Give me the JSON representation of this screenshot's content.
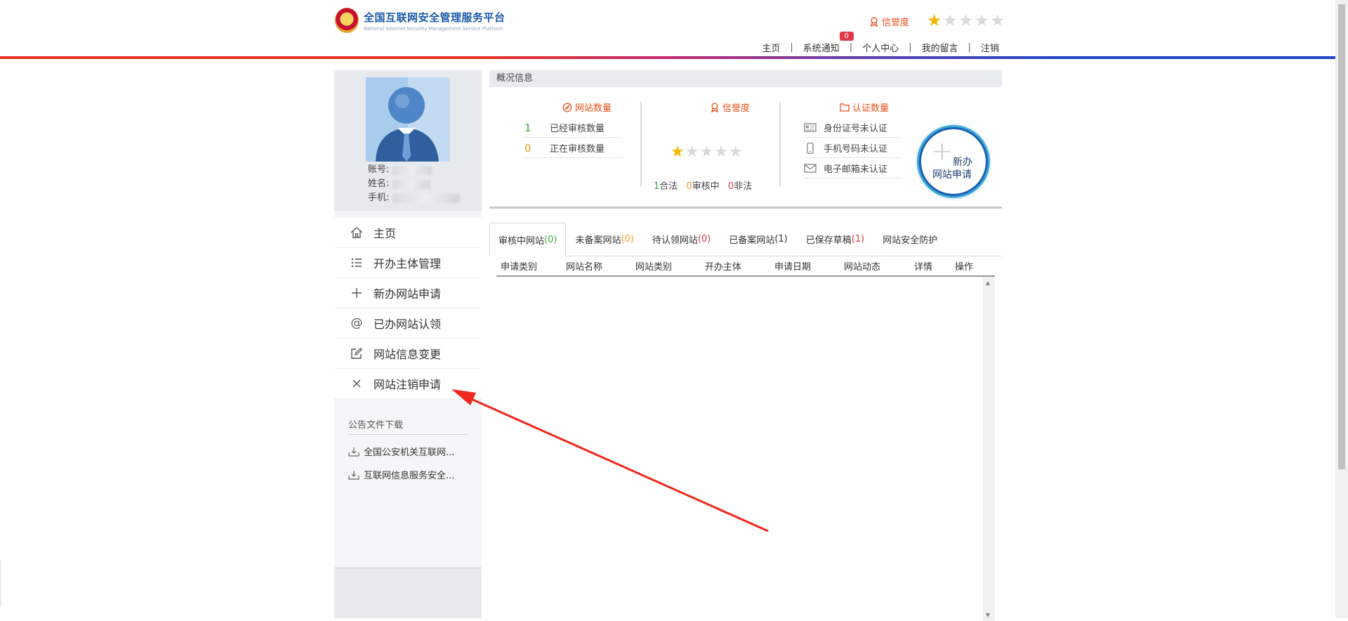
{
  "header": {
    "logo_cn": "全国互联网安全管理服务平台",
    "logo_en": "National Internet Security Management Service Platform",
    "credit_label": "信誉度",
    "credit_stars": 1,
    "credit_stars_max": 5,
    "nav": {
      "home": "主页",
      "notice": "系统通知",
      "notice_badge": "0",
      "personal": "个人中心",
      "messages": "我的留言",
      "logout": "注销"
    }
  },
  "profile": {
    "account_label": "账号:",
    "name_label": "姓名:",
    "phone_label": "手机:"
  },
  "sidebar": {
    "items": [
      {
        "label": "主页",
        "icon": "home-icon"
      },
      {
        "label": "开办主体管理",
        "icon": "list-icon"
      },
      {
        "label": "新办网站申请",
        "icon": "plus-icon"
      },
      {
        "label": "已办网站认领",
        "icon": "at-icon"
      },
      {
        "label": "网站信息变更",
        "icon": "edit-icon"
      },
      {
        "label": "网站注销申请",
        "icon": "close-icon"
      }
    ],
    "downloads_title": "公告文件下载",
    "downloads": [
      "全国公安机关互联网...",
      "互联网信息服务安全..."
    ]
  },
  "overview": {
    "section_title": "概况信息",
    "site_count": {
      "title": "网站数量",
      "reviewed_num": "1",
      "reviewed_label": "已经审核数量",
      "reviewing_num": "0",
      "reviewing_label": "正在审核数量"
    },
    "credit": {
      "title": "信誉度",
      "stars": 1,
      "legal_num": "1",
      "legal_label": "合法",
      "reviewing_num": "0",
      "reviewing_label": "审核中",
      "illegal_num": "0",
      "illegal_label": "非法"
    },
    "auth": {
      "title": "认证数量",
      "id_label": "身份证号未认证",
      "phone_label": "手机号码未认证",
      "email_label": "电子邮箱未认证"
    },
    "new_button": {
      "line1": "新办",
      "line2": "网站申请"
    }
  },
  "tabs": [
    {
      "label": "审核中网站",
      "count": "(0)",
      "count_color": "green",
      "active": true
    },
    {
      "label": "未备案网站",
      "count": "(0)",
      "count_color": "orange",
      "active": false
    },
    {
      "label": "待认领网站",
      "count": "(0)",
      "count_color": "red",
      "active": false
    },
    {
      "label": "已备案网站",
      "count": "(1)",
      "count_color": "dark",
      "active": false
    },
    {
      "label": "已保存草稿",
      "count": "(1)",
      "count_color": "red",
      "active": false
    },
    {
      "label": "网站安全防护",
      "count": "",
      "count_color": "dark",
      "active": false
    }
  ],
  "table": {
    "columns": [
      "申请类别",
      "网站名称",
      "网站类别",
      "开办主体",
      "申请日期",
      "网站动态",
      "详情",
      "操作"
    ],
    "rows": []
  },
  "colors": {
    "accent_orange": "#e8501c",
    "brand_blue": "#1b5aa8",
    "star_on": "#f5b800",
    "star_off": "#d9d9d9",
    "annotation_arrow": "#f0281e"
  }
}
